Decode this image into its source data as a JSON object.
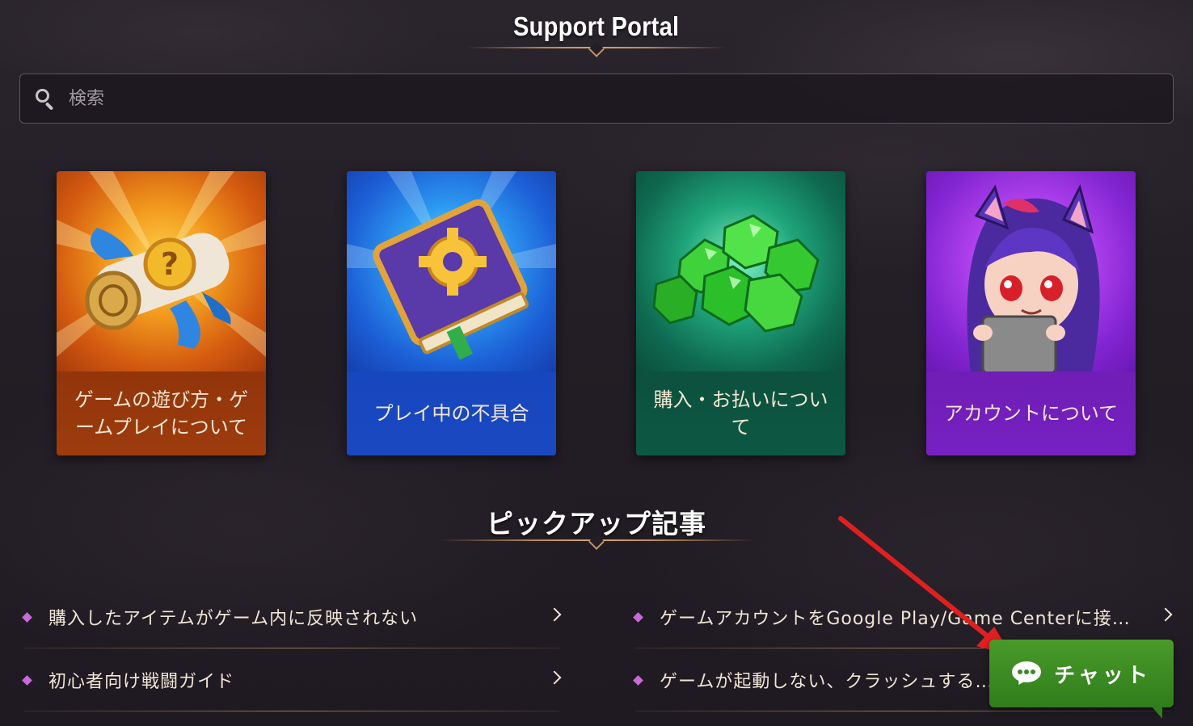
{
  "header": {
    "title": "Support Portal"
  },
  "search": {
    "placeholder": "検索"
  },
  "categories": [
    {
      "label": "ゲームの遊び方・ゲームプレイについて",
      "icon": "quest-scroll-icon"
    },
    {
      "label": "プレイ中の不具合",
      "icon": "gear-book-icon"
    },
    {
      "label": "購入・お払いについて",
      "icon": "gems-icon"
    },
    {
      "label": "アカウントについて",
      "icon": "character-avatar-icon"
    }
  ],
  "pickup": {
    "title": "ピックアップ記事",
    "articles": [
      {
        "text": "購入したアイテムがゲーム内に反映されない"
      },
      {
        "text": "初心者向け戦闘ガイド"
      },
      {
        "text": "ゲームアカウントをGoogle Play/Game Centerに接続する…"
      },
      {
        "text": "ゲームが起動しない、クラッシュする…"
      }
    ]
  },
  "chat": {
    "label": "チャット",
    "icon": "chat-bubble-icon"
  },
  "colors": {
    "accent_gold": "#c49468",
    "chat_green": "#3a8a22",
    "bullet": "#c86ad8",
    "annotation_arrow": "#e02020"
  }
}
